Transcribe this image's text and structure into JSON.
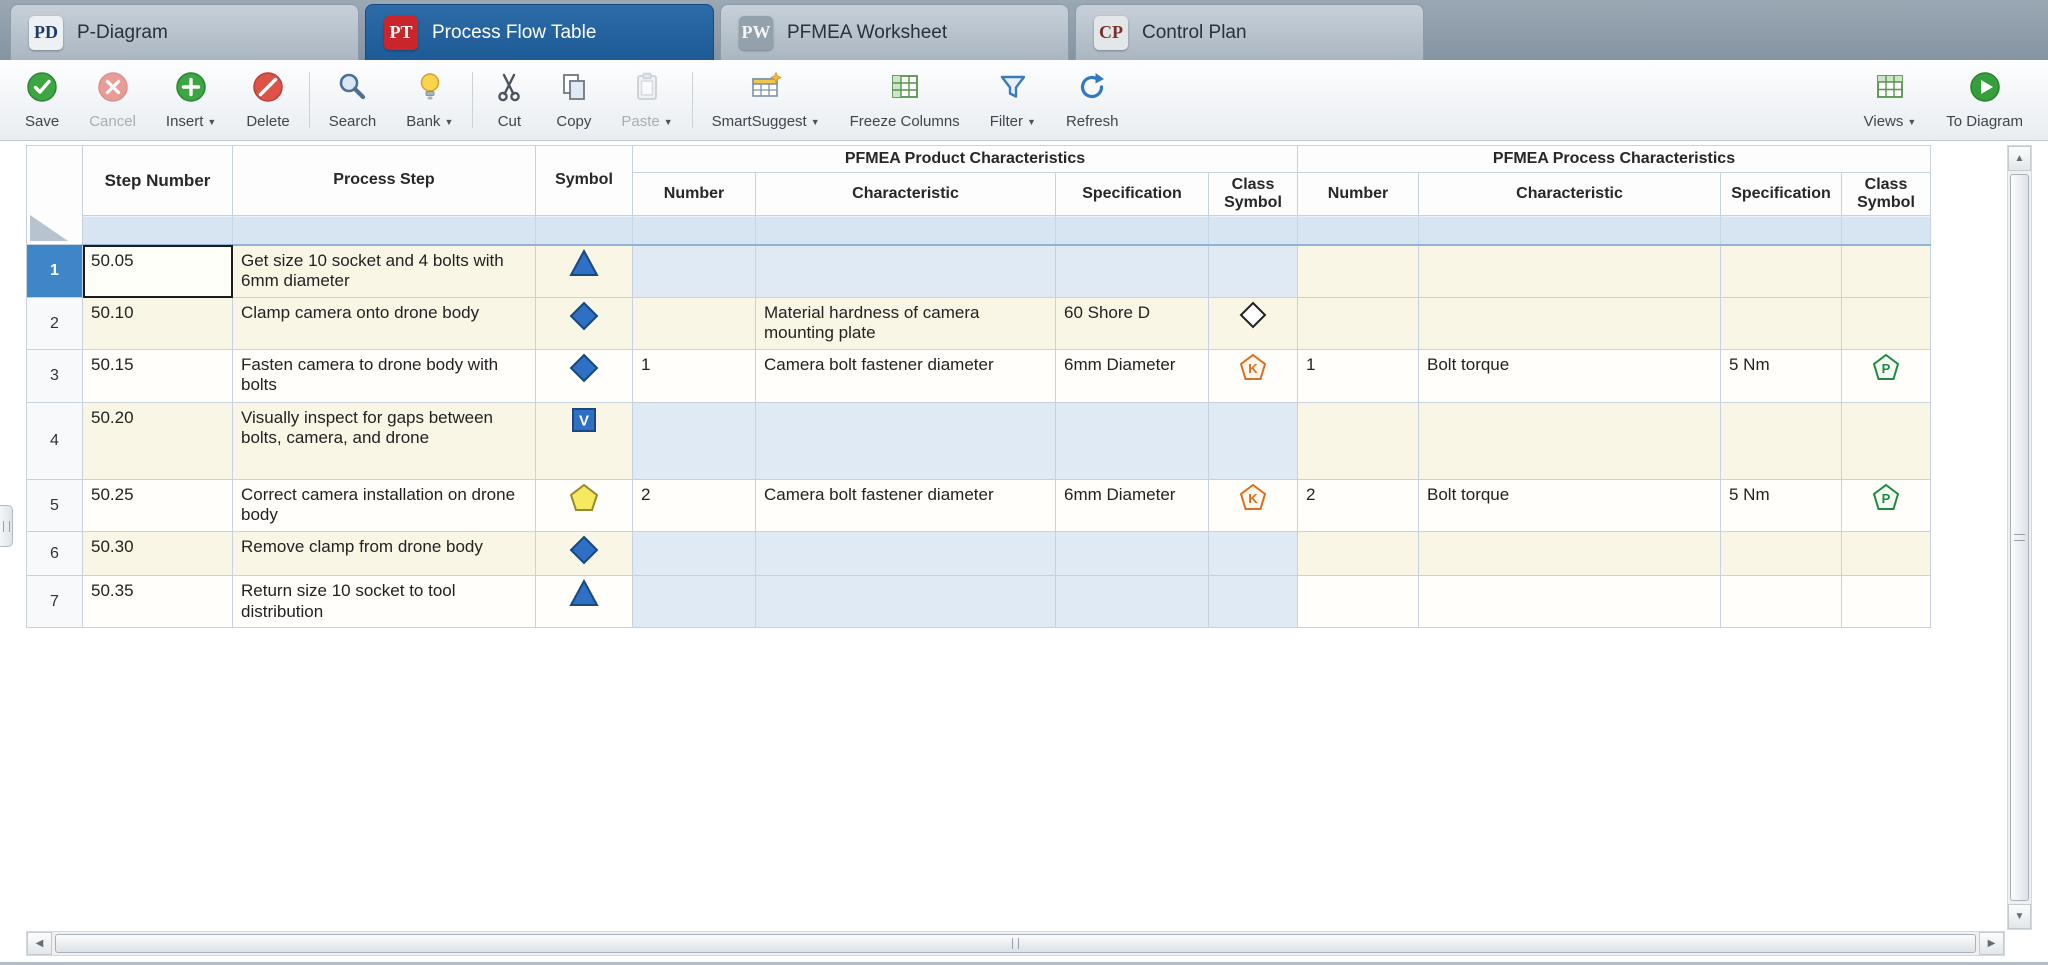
{
  "colors": {
    "active_tab": "#1d5a96",
    "selected_header": "#3e86c7",
    "symbol_blue": "#2f6fc4",
    "symbol_blue_dark": "#17497f",
    "symbol_yellow": "#f7e95f",
    "symbol_yellow_dark": "#938b2e",
    "class_k_orange": "#d96f1f",
    "class_p_green": "#1f8a3b",
    "class_diamond_black": "#222222",
    "row_cream": "#faf6e6",
    "row_tint_blue": "#dfeaf5"
  },
  "tabs": [
    {
      "badge": "PD",
      "badge_bg": "#eef1f4",
      "badge_color": "#1e3a66",
      "label": "P-Diagram",
      "active": false
    },
    {
      "badge": "PT",
      "badge_bg": "#c9252b",
      "badge_color": "#ffffff",
      "label": "Process Flow Table",
      "active": true
    },
    {
      "badge": "PW",
      "badge_bg": "#93a1ad",
      "badge_color": "#f4f6f8",
      "label": "PFMEA Worksheet",
      "active": false
    },
    {
      "badge": "CP",
      "badge_bg": "#e3e7ea",
      "badge_color": "#7a2f2f",
      "label": "Control Plan",
      "active": false
    }
  ],
  "toolbar": {
    "left": [
      {
        "id": "save",
        "label": "Save",
        "icon": "check-circle",
        "enabled": true,
        "dropdown": false
      },
      {
        "id": "cancel",
        "label": "Cancel",
        "icon": "x-circle",
        "enabled": false,
        "dropdown": false
      },
      {
        "id": "insert",
        "label": "Insert",
        "icon": "plus-circle",
        "enabled": true,
        "dropdown": true
      },
      {
        "id": "delete",
        "label": "Delete",
        "icon": "slash-circle",
        "enabled": true,
        "dropdown": false
      },
      {
        "type": "sep"
      },
      {
        "id": "search",
        "label": "Search",
        "icon": "magnifier",
        "enabled": true,
        "dropdown": false
      },
      {
        "id": "bank",
        "label": "Bank",
        "icon": "lightbulb",
        "enabled": true,
        "dropdown": true
      },
      {
        "type": "sep"
      },
      {
        "id": "cut",
        "label": "Cut",
        "icon": "scissors",
        "enabled": true,
        "dropdown": false
      },
      {
        "id": "copy",
        "label": "Copy",
        "icon": "copy",
        "enabled": true,
        "dropdown": false
      },
      {
        "id": "paste",
        "label": "Paste",
        "icon": "clipboard",
        "enabled": false,
        "dropdown": true
      },
      {
        "type": "sep"
      },
      {
        "id": "smartsuggest",
        "label": "SmartSuggest",
        "icon": "smart-table",
        "enabled": true,
        "dropdown": true
      },
      {
        "id": "freeze-columns",
        "label": "Freeze Columns",
        "icon": "freeze-table",
        "enabled": true,
        "dropdown": false
      },
      {
        "id": "filter",
        "label": "Filter",
        "icon": "funnel",
        "enabled": true,
        "dropdown": true
      },
      {
        "id": "refresh",
        "label": "Refresh",
        "icon": "refresh",
        "enabled": true,
        "dropdown": false
      }
    ],
    "right": [
      {
        "id": "views",
        "label": "Views",
        "icon": "views-table",
        "enabled": true,
        "dropdown": true
      },
      {
        "id": "to-diagram",
        "label": "To Diagram",
        "icon": "play-circle",
        "enabled": true,
        "dropdown": false
      }
    ]
  },
  "table": {
    "groups": [
      "PFMEA Product Characteristics",
      "PFMEA Process Characteristics"
    ],
    "columns": {
      "step_number": "Step Number",
      "process_step": "Process Step",
      "symbol": "Symbol"
    },
    "sub_columns": [
      "Number",
      "Characteristic",
      "Specification",
      "Class Symbol"
    ],
    "rows": [
      {
        "num": 1,
        "selected": true,
        "shade": "cream",
        "product_tint": true,
        "step": "50.05",
        "process_step": "Get size 10 socket and 4 bolts with 6mm diameter",
        "symbol": "triangle",
        "product": {
          "number": "",
          "characteristic": "",
          "specification": "",
          "class_symbol": ""
        },
        "process": {
          "number": "",
          "characteristic": "",
          "specification": "",
          "class_symbol": ""
        }
      },
      {
        "num": 2,
        "selected": false,
        "shade": "cream",
        "product_tint": false,
        "step": "50.10",
        "process_step": "Clamp camera onto drone body",
        "symbol": "diamond",
        "product": {
          "number": "",
          "characteristic": "Material hardness of camera mounting plate",
          "specification": "60 Shore D",
          "class_symbol": "diamond-outline"
        },
        "process": {
          "number": "",
          "characteristic": "",
          "specification": "",
          "class_symbol": ""
        }
      },
      {
        "num": 3,
        "selected": false,
        "shade": "white",
        "product_tint": false,
        "step": "50.15",
        "process_step": "Fasten camera to drone body with bolts",
        "symbol": "diamond",
        "product": {
          "number": "1",
          "characteristic": "Camera bolt fastener diameter",
          "specification": "6mm Diameter",
          "class_symbol": "K"
        },
        "process": {
          "number": "1",
          "characteristic": "Bolt torque",
          "specification": "5 Nm",
          "class_symbol": "P"
        }
      },
      {
        "num": 4,
        "selected": false,
        "shade": "cream",
        "product_tint": true,
        "step": "50.20",
        "process_step": "Visually inspect for gaps between bolts, camera, and drone",
        "symbol": "inspection",
        "product": {
          "number": "",
          "characteristic": "",
          "specification": "",
          "class_symbol": ""
        },
        "process": {
          "number": "",
          "characteristic": "",
          "specification": "",
          "class_symbol": ""
        }
      },
      {
        "num": 5,
        "selected": false,
        "shade": "white",
        "product_tint": false,
        "step": "50.25",
        "process_step": "Correct camera installation on drone body",
        "symbol": "pentagon",
        "product": {
          "number": "2",
          "characteristic": "Camera bolt fastener diameter",
          "specification": "6mm Diameter",
          "class_symbol": "K"
        },
        "process": {
          "number": "2",
          "characteristic": "Bolt torque",
          "specification": "5 Nm",
          "class_symbol": "P"
        }
      },
      {
        "num": 6,
        "selected": false,
        "shade": "cream",
        "product_tint": true,
        "step": "50.30",
        "process_step": "Remove clamp from drone body",
        "symbol": "diamond",
        "product": {
          "number": "",
          "characteristic": "",
          "specification": "",
          "class_symbol": ""
        },
        "process": {
          "number": "",
          "characteristic": "",
          "specification": "",
          "class_symbol": ""
        }
      },
      {
        "num": 7,
        "selected": false,
        "shade": "white",
        "product_tint": true,
        "step": "50.35",
        "process_step": "Return size 10 socket to tool distribution",
        "symbol": "triangle",
        "product": {
          "number": "",
          "characteristic": "",
          "specification": "",
          "class_symbol": ""
        },
        "process": {
          "number": "",
          "characteristic": "",
          "specification": "",
          "class_symbol": ""
        }
      }
    ]
  }
}
